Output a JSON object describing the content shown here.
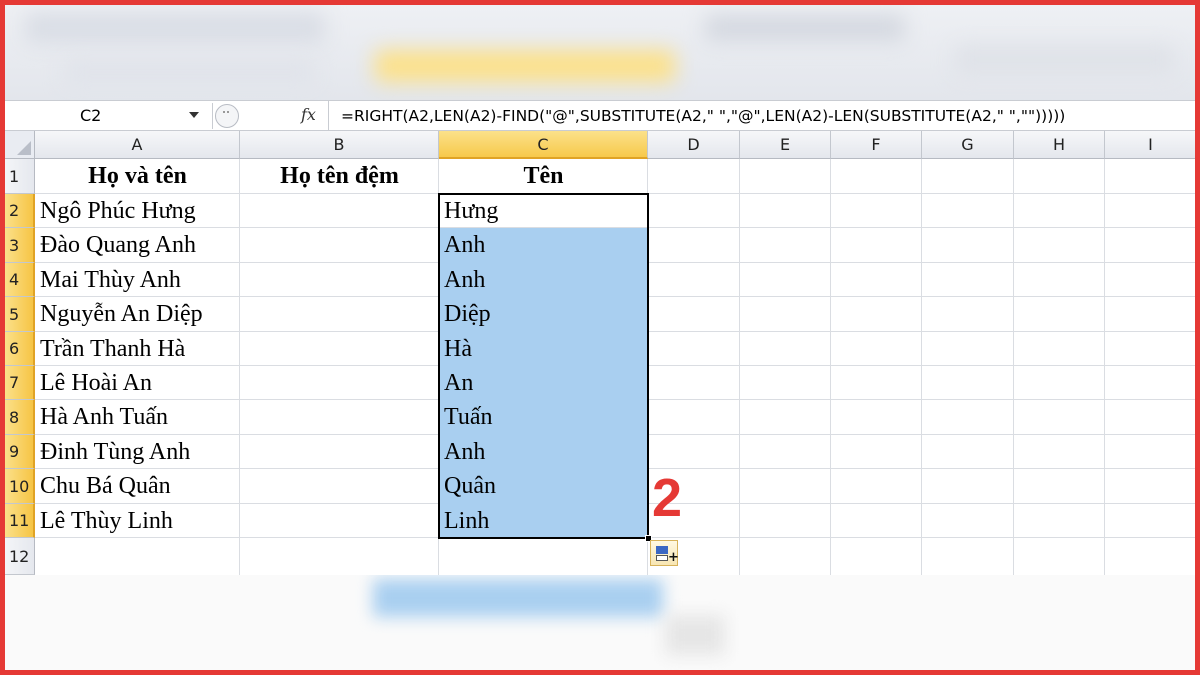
{
  "formula_bar": {
    "name_box": "C2",
    "fx_label": "fx",
    "formula": "=RIGHT(A2,LEN(A2)-FIND(\"@\",SUBSTITUTE(A2,\" \",\"@\",LEN(A2)-LEN(SUBSTITUTE(A2,\" \",\"\")))))"
  },
  "columns": [
    "A",
    "B",
    "C",
    "D",
    "E",
    "F",
    "G",
    "H",
    "I"
  ],
  "selected_column": "C",
  "rows": [
    "1",
    "2",
    "3",
    "4",
    "5",
    "6",
    "7",
    "8",
    "9",
    "10",
    "11",
    "12"
  ],
  "headers": {
    "a": "Họ và tên",
    "b": "Họ tên đệm",
    "c": "Tên"
  },
  "names": [
    "Ngô Phúc Hưng",
    "Đào Quang Anh",
    "Mai Thùy Anh",
    "Nguyễn An Diệp",
    "Trần Thanh Hà",
    "Lê Hoài An",
    "Hà Anh Tuấn",
    "Đinh Tùng Anh",
    "Chu Bá Quân",
    "Lê Thùy Linh"
  ],
  "first_names": [
    "Hưng",
    "Anh",
    "Anh",
    "Diệp",
    "Hà",
    "An",
    "Tuấn",
    "Anh",
    "Quân",
    "Linh"
  ],
  "step_label": "2",
  "colors": {
    "frame": "#e53935",
    "selection_fill": "#a9cff0",
    "header_highlight": "#f7c94b"
  }
}
